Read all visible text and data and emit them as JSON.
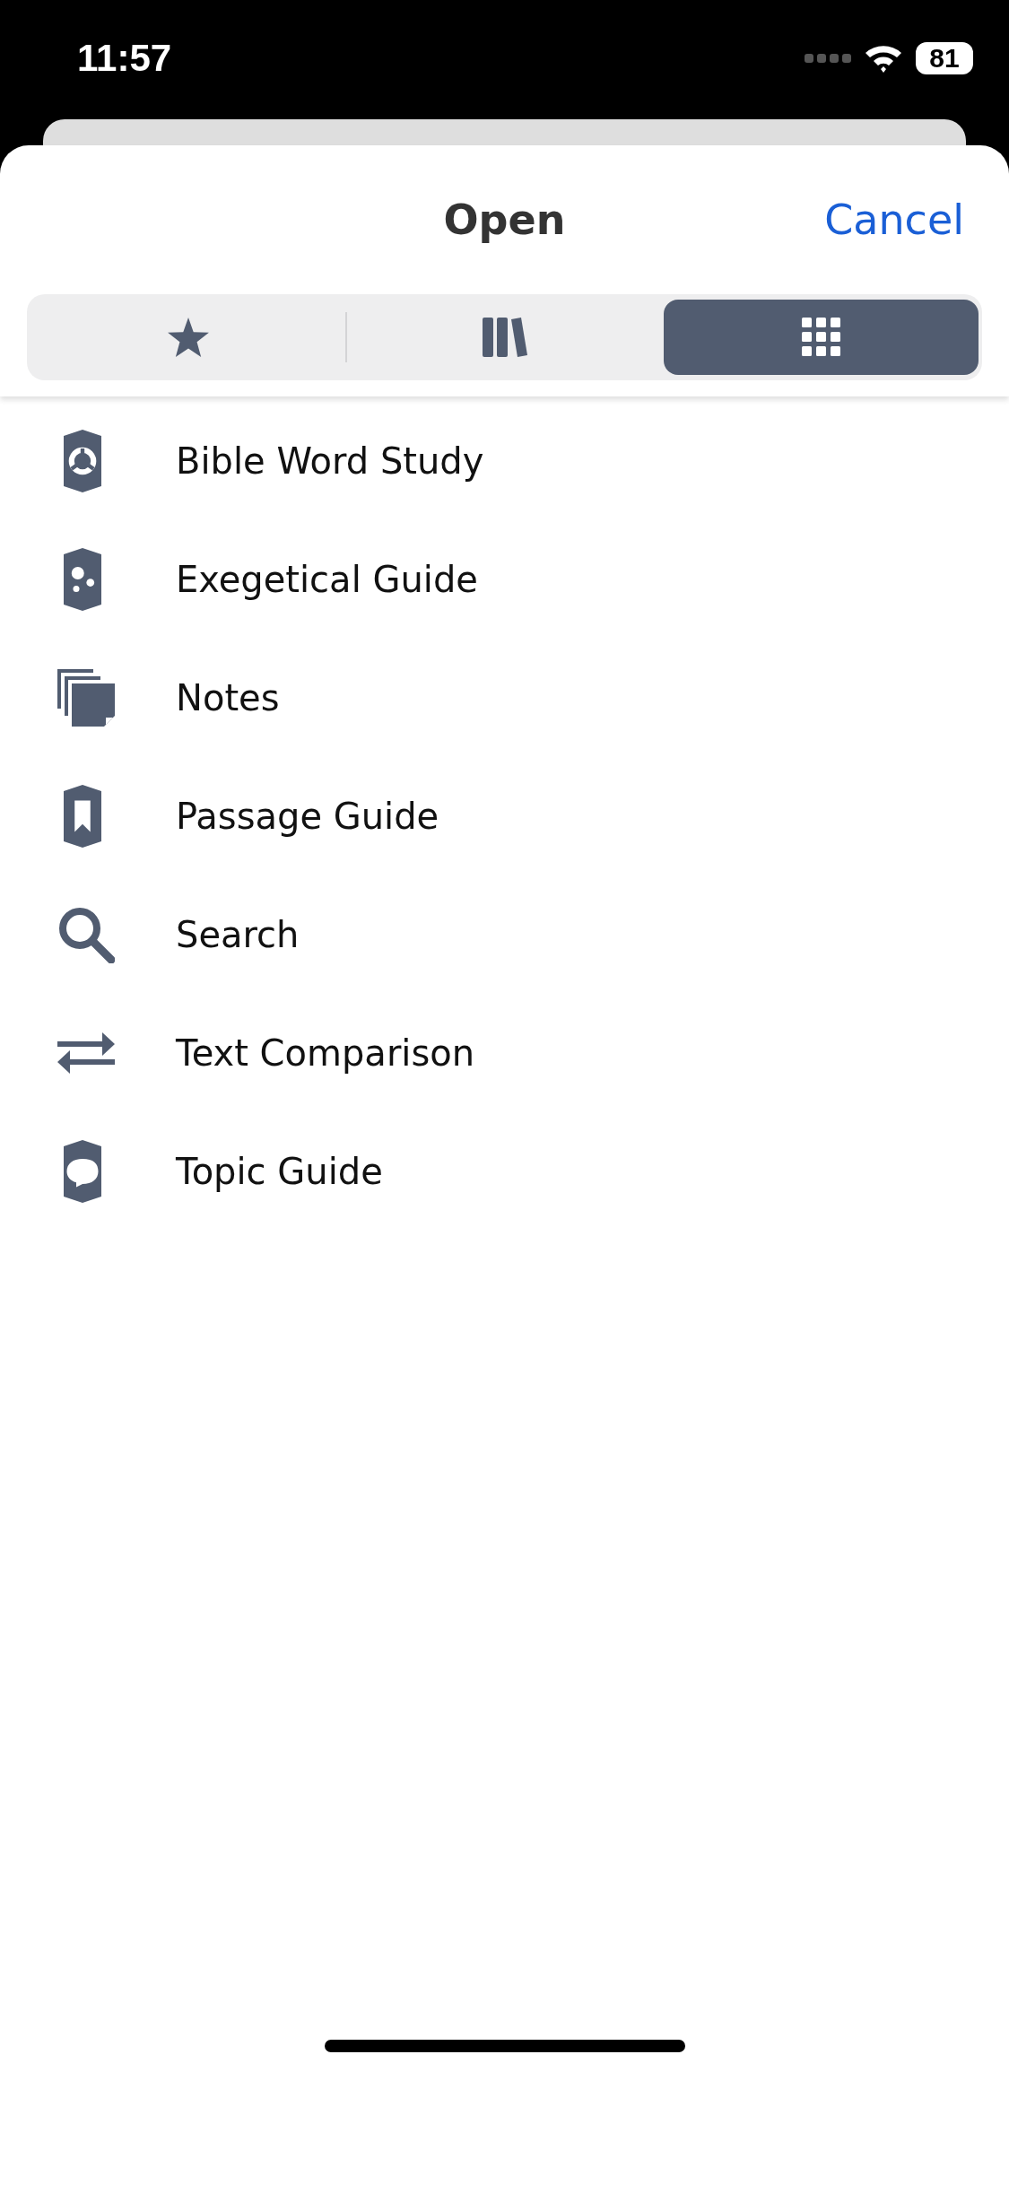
{
  "status_bar": {
    "time": "11:57",
    "battery": "81"
  },
  "header": {
    "title": "Open",
    "cancel": "Cancel"
  },
  "tabs": [
    {
      "kind": "favorites",
      "selected": false
    },
    {
      "kind": "library",
      "selected": false
    },
    {
      "kind": "tools",
      "selected": true
    }
  ],
  "items": [
    {
      "kind": "word-study",
      "label": "Bible Word Study"
    },
    {
      "kind": "exegetical",
      "label": "Exegetical Guide"
    },
    {
      "kind": "notes",
      "label": "Notes"
    },
    {
      "kind": "passage",
      "label": "Passage Guide"
    },
    {
      "kind": "search",
      "label": "Search"
    },
    {
      "kind": "compare",
      "label": "Text Comparison"
    },
    {
      "kind": "topic",
      "label": "Topic Guide"
    }
  ]
}
